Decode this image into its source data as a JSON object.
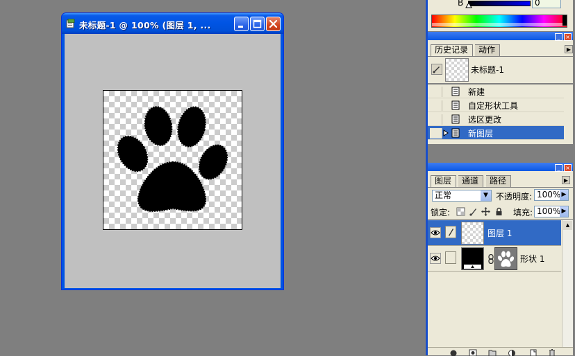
{
  "document": {
    "title": "未标题-1 @ 100% (图层 1, ..."
  },
  "color_panel": {
    "channel_label": "B",
    "channel_value": "0"
  },
  "history_panel": {
    "tabs": [
      "历史记录",
      "动作"
    ],
    "snapshot_label": "未标题-1",
    "items": [
      "新建",
      "自定形状工具",
      "选区更改",
      "新图层"
    ],
    "selected_index": 3
  },
  "layers_panel": {
    "tabs": [
      "图层",
      "通道",
      "路径"
    ],
    "blend_mode": "正常",
    "opacity_label": "不透明度:",
    "opacity_value": "100%",
    "lock_label": "锁定:",
    "fill_label": "填充:",
    "fill_value": "100%",
    "layers": [
      {
        "name": "图层 1",
        "selected": true
      },
      {
        "name": "形状 1",
        "selected": false
      }
    ]
  },
  "colors": {
    "titlebar": "#0054e3",
    "selection": "#316ac5",
    "panel_bg": "#ece9d8",
    "workspace": "#7f7f7f"
  },
  "icons": {
    "doc_icon": "photoshop-document-icon",
    "minimize": "minimize-icon",
    "maximize": "maximize-icon",
    "close": "close-icon",
    "history_state": "history-state-icon",
    "eye": "eye-icon",
    "brush": "brush-icon",
    "link": "chain-link-icon",
    "trash": "trash-icon"
  }
}
